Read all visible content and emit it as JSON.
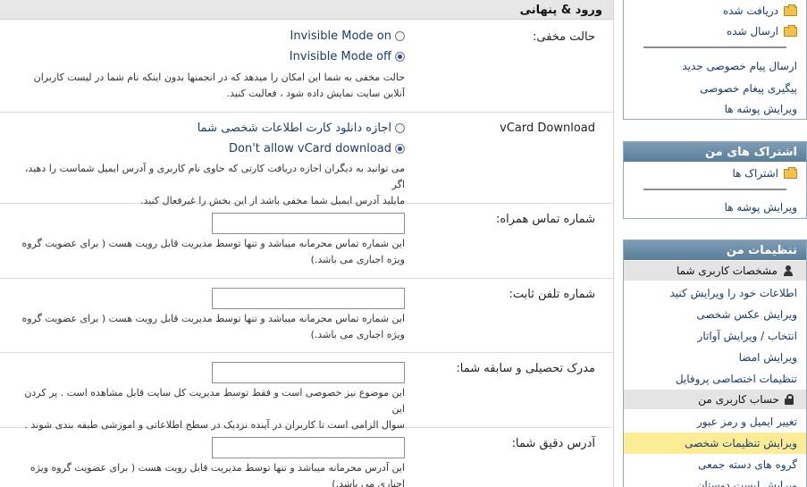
{
  "main": {
    "title": "ورود & پنهانی",
    "invisible": {
      "label": "حالت مخفی:",
      "option_on": "Invisible Mode on",
      "option_off": "Invisible Mode off",
      "desc1": "حالت مخفی به شما این امکان را میدهد که در انجمنها بدون اینکه نام شما در لیست کاربران",
      "desc2": "آنلاین سایت نمایش داده شود ، فعالیت کنید."
    },
    "vcard": {
      "label": "vCard Download",
      "option_allow": "اجازه دانلود کارت اطلاعات شخصی شما",
      "option_deny": "Don't allow vCard download",
      "desc1": "می توانید به دیگران اجازه دریافت کارتی که حاوی نام کاربری و آدرس ایمیل شماست را دهید، اگر",
      "desc2": "مایلید آدرس ایمیل شما مخفی باشد از این بخش را غیرفعال کنید."
    },
    "mobile": {
      "label": "شماره تماس همراه:",
      "value": "",
      "desc1": "این شماره تماس محرمانه میباشد و تنها توسط مدیریت قابل رویت هست ( برای عضویت گروه",
      "desc2": "ویژه اجباری می باشد.)"
    },
    "landline": {
      "label": "شماره تلفن ثابت:",
      "value": "",
      "desc1": "این شماره تماس محرمانه میباشد و تنها توسط مدیریت قابل رویت هست ( برای عضویت گروه",
      "desc2": "ویژه اجباری می باشد.)"
    },
    "education": {
      "label": "مدرک تحصیلی و سابقه شما:",
      "value": "",
      "desc1": "این موضوع نیز خصوصی است و فقط توسط مدیریت کل سایت قابل مشاهده است . پر کردن این",
      "desc2": "سوال الزامی است تا کاربران در آینده نزدیک در سطح اطلاعاتی و اموزشی طبقه بندی شوند ."
    },
    "address": {
      "label": "آدرس دقیق شما:",
      "value": "",
      "desc1": "این آدرس محرمانه میباشد و تنها توسط مدیریت قابل رویت هست ( برای عضویت گروه ویژه",
      "desc2": "اجباری می باشد.)"
    }
  },
  "sidebar": {
    "messages": {
      "inbox": "دریافت شده",
      "sent": "ارسال شده",
      "new_pm": "ارسال پیام خصوصی جدید",
      "track_pm": "پیگیری پیغام خصوصی",
      "edit_folders": "ویرایش پوشه ها"
    },
    "subscriptions": {
      "title": "اشتراک های من",
      "folder": "اشتراک ها",
      "edit_folders": "ویرایش پوشه ها"
    },
    "settings": {
      "title": "تنظیمات من",
      "profile_head": "مشخصات کاربری شما",
      "edit_details": "اطلاعات خود را ویرایش کنید",
      "edit_photo": "ویرایش عکس شخصی",
      "avatar": "انتخاب / ویرایش آواتار",
      "signature": "ویرایش امضا",
      "privacy": "تنظیمات اختصاصی پروفایل",
      "account_head": "حساب کاربری من",
      "email_pass": "تغییر ایمیل و رمز عبور",
      "edit_options": "ویرایش تنظیمات شخصی",
      "groups": "گروه های دسته جمعی",
      "cut_item": "ویرایش لیست دوستان"
    }
  }
}
